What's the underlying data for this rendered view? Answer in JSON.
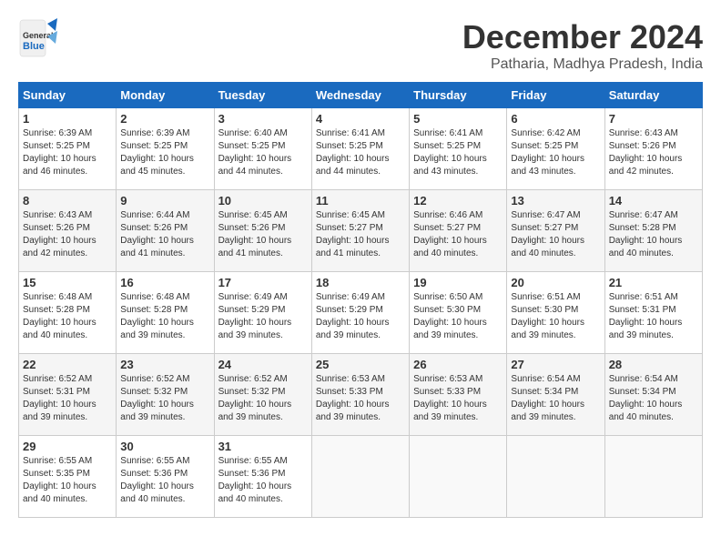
{
  "header": {
    "logo_general": "General",
    "logo_blue": "Blue",
    "month_title": "December 2024",
    "location": "Patharia, Madhya Pradesh, India"
  },
  "calendar": {
    "days_of_week": [
      "Sunday",
      "Monday",
      "Tuesday",
      "Wednesday",
      "Thursday",
      "Friday",
      "Saturday"
    ],
    "weeks": [
      [
        {
          "day": "",
          "info": ""
        },
        {
          "day": "2",
          "info": "Sunrise: 6:39 AM\nSunset: 5:25 PM\nDaylight: 10 hours\nand 45 minutes."
        },
        {
          "day": "3",
          "info": "Sunrise: 6:40 AM\nSunset: 5:25 PM\nDaylight: 10 hours\nand 44 minutes."
        },
        {
          "day": "4",
          "info": "Sunrise: 6:41 AM\nSunset: 5:25 PM\nDaylight: 10 hours\nand 44 minutes."
        },
        {
          "day": "5",
          "info": "Sunrise: 6:41 AM\nSunset: 5:25 PM\nDaylight: 10 hours\nand 43 minutes."
        },
        {
          "day": "6",
          "info": "Sunrise: 6:42 AM\nSunset: 5:25 PM\nDaylight: 10 hours\nand 43 minutes."
        },
        {
          "day": "7",
          "info": "Sunrise: 6:43 AM\nSunset: 5:26 PM\nDaylight: 10 hours\nand 42 minutes."
        }
      ],
      [
        {
          "day": "1",
          "info": "Sunrise: 6:39 AM\nSunset: 5:25 PM\nDaylight: 10 hours\nand 46 minutes."
        },
        {
          "day": "9",
          "info": "Sunrise: 6:44 AM\nSunset: 5:26 PM\nDaylight: 10 hours\nand 41 minutes."
        },
        {
          "day": "10",
          "info": "Sunrise: 6:45 AM\nSunset: 5:26 PM\nDaylight: 10 hours\nand 41 minutes."
        },
        {
          "day": "11",
          "info": "Sunrise: 6:45 AM\nSunset: 5:27 PM\nDaylight: 10 hours\nand 41 minutes."
        },
        {
          "day": "12",
          "info": "Sunrise: 6:46 AM\nSunset: 5:27 PM\nDaylight: 10 hours\nand 40 minutes."
        },
        {
          "day": "13",
          "info": "Sunrise: 6:47 AM\nSunset: 5:27 PM\nDaylight: 10 hours\nand 40 minutes."
        },
        {
          "day": "14",
          "info": "Sunrise: 6:47 AM\nSunset: 5:28 PM\nDaylight: 10 hours\nand 40 minutes."
        }
      ],
      [
        {
          "day": "8",
          "info": "Sunrise: 6:43 AM\nSunset: 5:26 PM\nDaylight: 10 hours\nand 42 minutes."
        },
        {
          "day": "16",
          "info": "Sunrise: 6:48 AM\nSunset: 5:28 PM\nDaylight: 10 hours\nand 39 minutes."
        },
        {
          "day": "17",
          "info": "Sunrise: 6:49 AM\nSunset: 5:29 PM\nDaylight: 10 hours\nand 39 minutes."
        },
        {
          "day": "18",
          "info": "Sunrise: 6:49 AM\nSunset: 5:29 PM\nDaylight: 10 hours\nand 39 minutes."
        },
        {
          "day": "19",
          "info": "Sunrise: 6:50 AM\nSunset: 5:30 PM\nDaylight: 10 hours\nand 39 minutes."
        },
        {
          "day": "20",
          "info": "Sunrise: 6:51 AM\nSunset: 5:30 PM\nDaylight: 10 hours\nand 39 minutes."
        },
        {
          "day": "21",
          "info": "Sunrise: 6:51 AM\nSunset: 5:31 PM\nDaylight: 10 hours\nand 39 minutes."
        }
      ],
      [
        {
          "day": "15",
          "info": "Sunrise: 6:48 AM\nSunset: 5:28 PM\nDaylight: 10 hours\nand 40 minutes."
        },
        {
          "day": "23",
          "info": "Sunrise: 6:52 AM\nSunset: 5:32 PM\nDaylight: 10 hours\nand 39 minutes."
        },
        {
          "day": "24",
          "info": "Sunrise: 6:52 AM\nSunset: 5:32 PM\nDaylight: 10 hours\nand 39 minutes."
        },
        {
          "day": "25",
          "info": "Sunrise: 6:53 AM\nSunset: 5:33 PM\nDaylight: 10 hours\nand 39 minutes."
        },
        {
          "day": "26",
          "info": "Sunrise: 6:53 AM\nSunset: 5:33 PM\nDaylight: 10 hours\nand 39 minutes."
        },
        {
          "day": "27",
          "info": "Sunrise: 6:54 AM\nSunset: 5:34 PM\nDaylight: 10 hours\nand 39 minutes."
        },
        {
          "day": "28",
          "info": "Sunrise: 6:54 AM\nSunset: 5:34 PM\nDaylight: 10 hours\nand 40 minutes."
        }
      ],
      [
        {
          "day": "22",
          "info": "Sunrise: 6:52 AM\nSunset: 5:31 PM\nDaylight: 10 hours\nand 39 minutes."
        },
        {
          "day": "30",
          "info": "Sunrise: 6:55 AM\nSunset: 5:36 PM\nDaylight: 10 hours\nand 40 minutes."
        },
        {
          "day": "31",
          "info": "Sunrise: 6:55 AM\nSunset: 5:36 PM\nDaylight: 10 hours\nand 40 minutes."
        },
        {
          "day": "",
          "info": ""
        },
        {
          "day": "",
          "info": ""
        },
        {
          "day": "",
          "info": ""
        },
        {
          "day": ""
        }
      ],
      [
        {
          "day": "29",
          "info": "Sunrise: 6:55 AM\nSunset: 5:35 PM\nDaylight: 10 hours\nand 40 minutes."
        },
        {
          "day": "",
          "info": ""
        },
        {
          "day": "",
          "info": ""
        },
        {
          "day": "",
          "info": ""
        },
        {
          "day": "",
          "info": ""
        },
        {
          "day": "",
          "info": ""
        },
        {
          "day": "",
          "info": ""
        }
      ]
    ]
  }
}
